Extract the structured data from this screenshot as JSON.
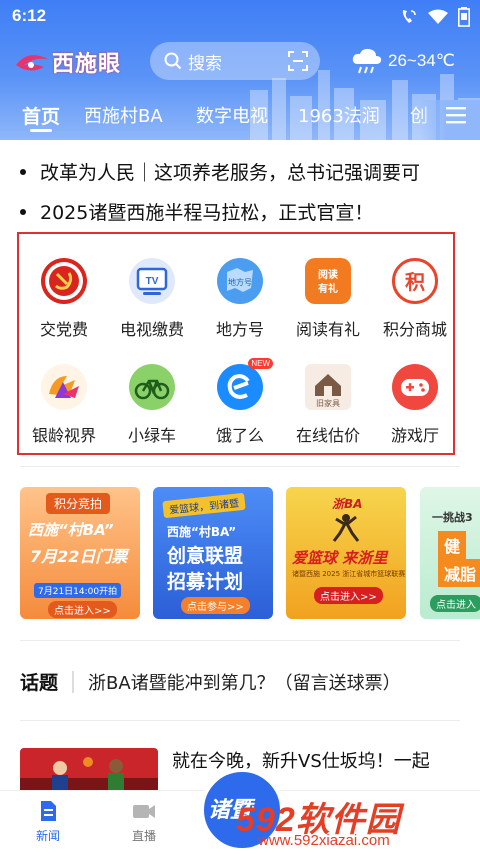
{
  "status": {
    "time": "6:12"
  },
  "header": {
    "logo_text": "西施眼",
    "search_placeholder": "搜索",
    "weather": "26~34℃"
  },
  "tabs": [
    {
      "label": "首页",
      "active": true
    },
    {
      "label": "西施村BA"
    },
    {
      "label": "数字电视"
    },
    {
      "label": "1963法润"
    },
    {
      "label": "创"
    }
  ],
  "headlines": [
    "改革为人民｜这项养老服务，总书记强调要可",
    "2025诸暨西施半程马拉松，正式官宣！"
  ],
  "services": [
    {
      "label": "交党费",
      "icon": "party-fee-icon"
    },
    {
      "label": "电视缴费",
      "icon": "tv-payment-icon"
    },
    {
      "label": "地方号",
      "icon": "local-account-icon",
      "glyph": "地方号"
    },
    {
      "label": "阅读有礼",
      "icon": "reading-gift-icon",
      "glyph": "阅读有礼"
    },
    {
      "label": "积分商城",
      "icon": "points-mall-icon",
      "glyph": "积"
    },
    {
      "label": "银龄视界",
      "icon": "silver-vision-icon"
    },
    {
      "label": "小绿车",
      "icon": "bicycle-icon"
    },
    {
      "label": "饿了么",
      "icon": "eleme-icon",
      "badge": "NEW"
    },
    {
      "label": "在线估价",
      "icon": "furniture-valuation-icon",
      "glyph": "旧家具"
    },
    {
      "label": "游戏厅",
      "icon": "game-hall-icon"
    }
  ],
  "banners": [
    {
      "tag": "积分竞拍",
      "title": "西施“村BA”",
      "subtitle": "7月22日门票",
      "note": "7月21日14:00开拍",
      "cta": "点击进入>>"
    },
    {
      "tag": "爱篮球，到诸暨",
      "title": "西施“村BA”",
      "subtitle": "创意联盟",
      "line3": "招募计划",
      "cta": "点击参与>>"
    },
    {
      "tag": "浙BA",
      "title": "爱篮球 来浙里",
      "subtitle": "诸暨西施 2025 浙江省城市篮球联赛",
      "cta": "点击进入>>"
    },
    {
      "tag": "一挑战3",
      "title": "健",
      "subtitle": "减脂",
      "cta": "点击进入"
    }
  ],
  "topic": {
    "label": "话题",
    "text": "浙BA诸暨能冲到第几？（留言送球票）"
  },
  "news": {
    "title": "就在今晚，新升VS仕坂坞！一起"
  },
  "bottom_nav": [
    {
      "label": "新闻",
      "active": true
    },
    {
      "label": "直播"
    }
  ],
  "float_button": {
    "text": "诸暨"
  },
  "watermark": {
    "big": "592软件园",
    "small": "www.592xiazai.com"
  },
  "colors": {
    "header_blue": "#3f7ef6",
    "active_nav": "#2d6bec",
    "highlight_border": "#e03030",
    "watermark": "#e63d25"
  }
}
